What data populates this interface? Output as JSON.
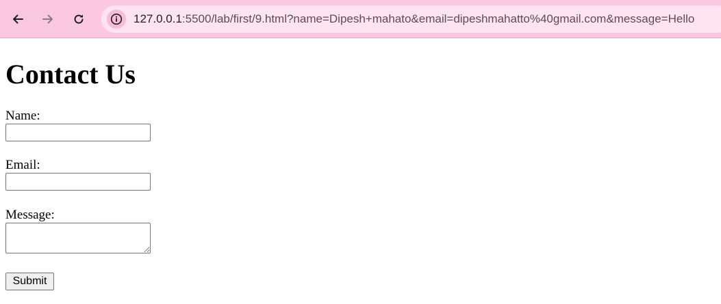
{
  "browser": {
    "url_host": "127.0.0.1",
    "url_rest": ":5500/lab/first/9.html?name=Dipesh+mahato&email=dipeshmahatto%40gmail.com&message=Hello",
    "toolbar_color": "#fbc8e2",
    "icons": {
      "back": "arrow-left-icon",
      "forward": "arrow-right-icon",
      "reload": "reload-icon",
      "site_info": "info-icon"
    }
  },
  "page": {
    "heading": "Contact Us",
    "form": {
      "name_label": "Name:",
      "name_value": "",
      "email_label": "Email:",
      "email_value": "",
      "message_label": "Message:",
      "message_value": "",
      "submit_label": "Submit"
    }
  }
}
